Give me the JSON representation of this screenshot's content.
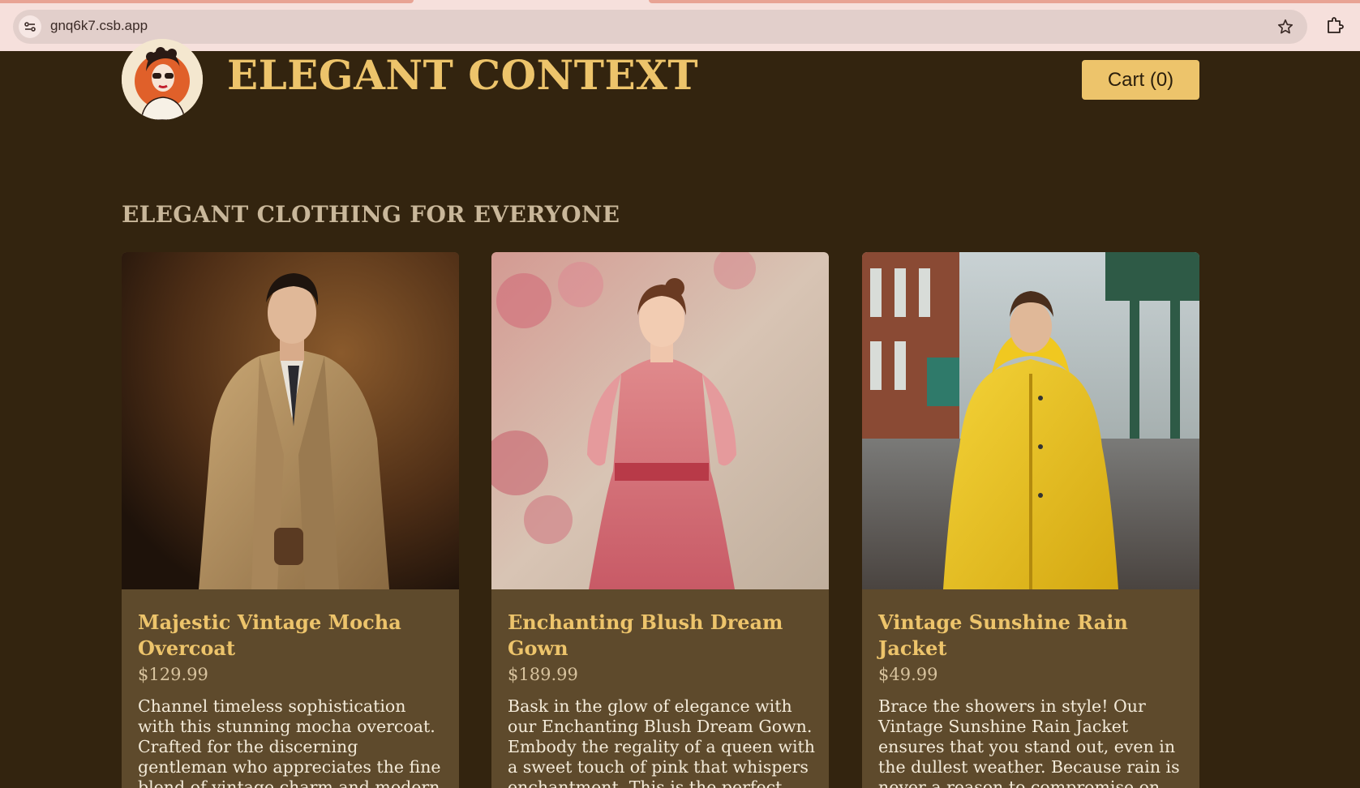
{
  "browser": {
    "url": "gnq6k7.csb.app"
  },
  "header": {
    "brand": "ELEGANT CONTEXT",
    "cart_label": "Cart (0)"
  },
  "section": {
    "title": "ELEGANT CLOTHING FOR EVERYONE"
  },
  "products": [
    {
      "title": "Majestic Vintage Mocha Overcoat",
      "price": "$129.99",
      "description": "Channel timeless sophistication with this stunning mocha overcoat. Crafted for the discerning gentleman who appreciates the fine blend of vintage charm and modern elegance."
    },
    {
      "title": "Enchanting Blush Dream Gown",
      "price": "$189.99",
      "description": "Bask in the glow of elegance with our Enchanting Blush Dream Gown. Embody the regality of a queen with a sweet touch of pink that whispers enchantment. This is the perfect piece"
    },
    {
      "title": "Vintage Sunshine Rain Jacket",
      "price": "$49.99",
      "description": "Brace the showers in style! Our Vintage Sunshine Rain Jacket ensures that you stand out, even in the dullest weather. Because rain is never a reason to compromise on your fashion quotient."
    }
  ],
  "colors": {
    "background": "#33240f",
    "accent": "#edc46b",
    "card": "#5e4a2c"
  }
}
